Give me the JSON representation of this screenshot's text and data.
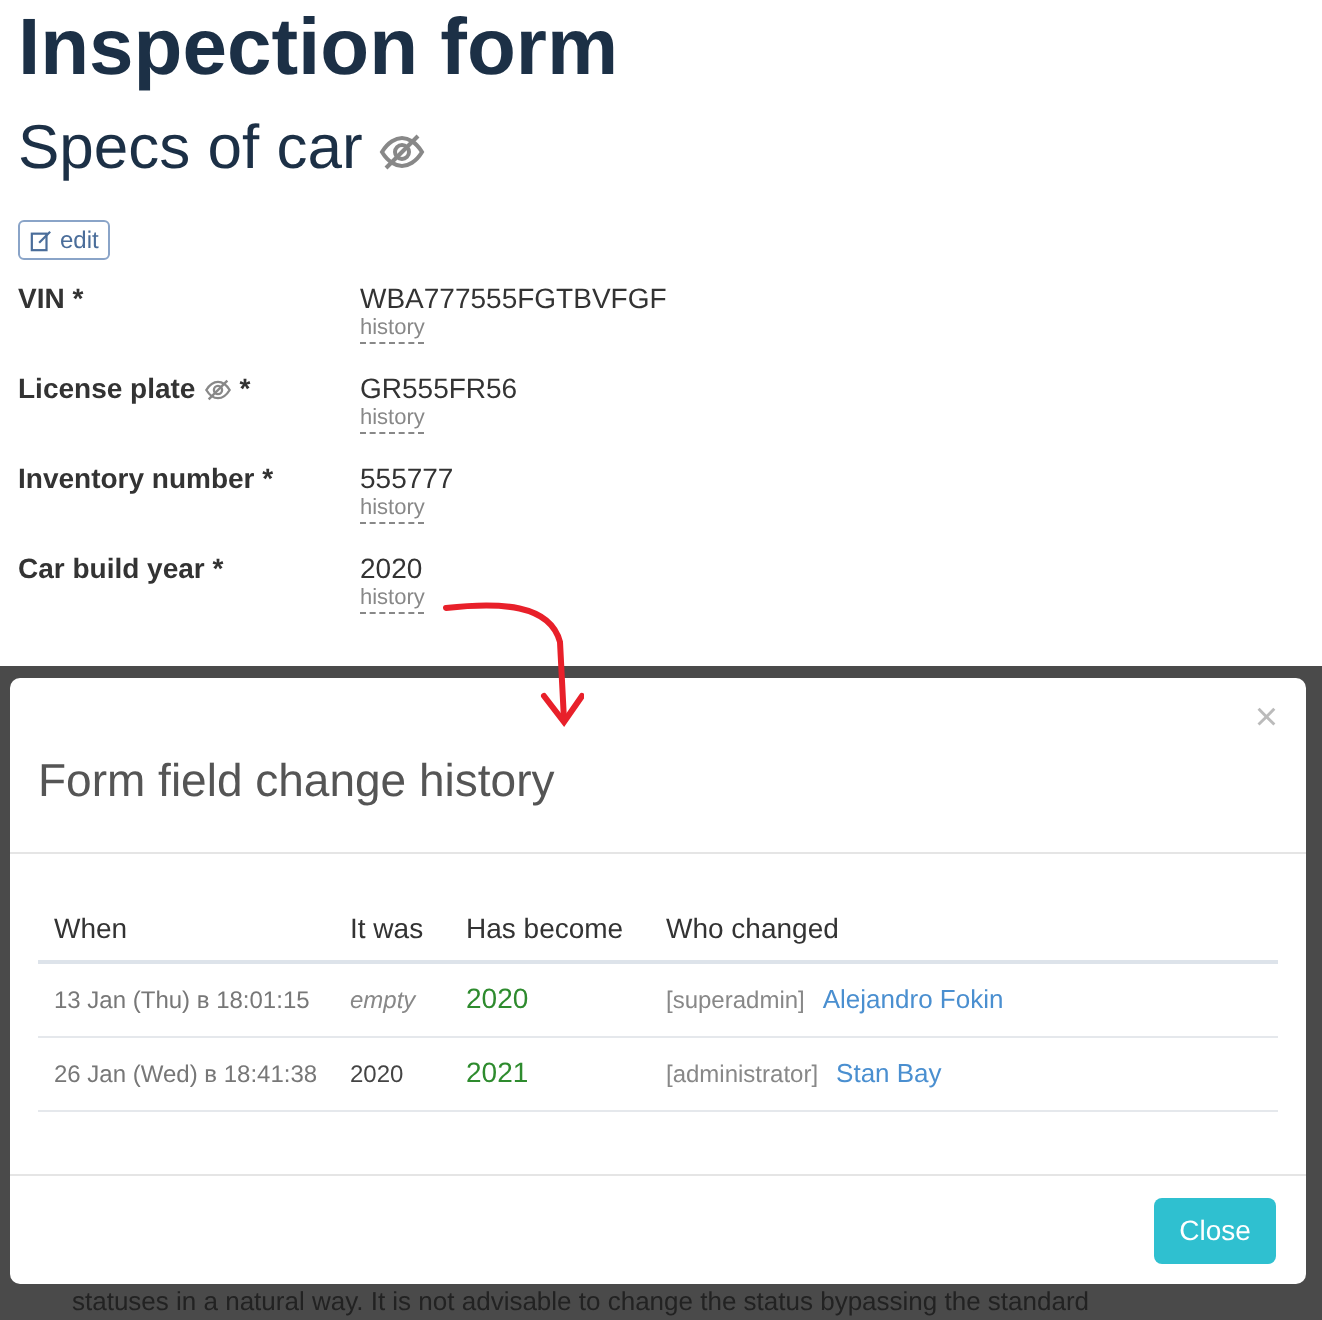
{
  "page_title": "Inspection form",
  "section": {
    "title": "Specs of car",
    "hidden": true,
    "edit_button": "edit"
  },
  "fields": [
    {
      "label": "VIN *",
      "hidden": false,
      "value": "WBA777555FGTBVFGF",
      "history_link": "history"
    },
    {
      "label": "License plate",
      "hidden": true,
      "required": "*",
      "value": "GR555FR56",
      "history_link": "history"
    },
    {
      "label": "Inventory number *",
      "hidden": false,
      "value": "555777",
      "history_link": "history"
    },
    {
      "label": "Car build year *",
      "hidden": false,
      "value": "2020",
      "history_link": "history"
    }
  ],
  "background_text": "statuses in a natural way. It is not advisable to change the status bypassing the standard",
  "modal": {
    "title": "Form field change history",
    "close_icon": "×",
    "table": {
      "columns": [
        "When",
        "It was",
        "Has become",
        "Who changed"
      ],
      "rows": [
        {
          "when": "13 Jan (Thu) в 18:01:15",
          "it_was": "empty",
          "it_was_empty": true,
          "has_become": "2020",
          "role": "[superadmin]",
          "user": "Alejandro Fokin"
        },
        {
          "when": "26 Jan (Wed) в 18:41:38",
          "it_was": "2020",
          "it_was_empty": false,
          "has_become": "2021",
          "role": "[administrator]",
          "user": "Stan Bay"
        }
      ]
    },
    "close_button": "Close"
  }
}
